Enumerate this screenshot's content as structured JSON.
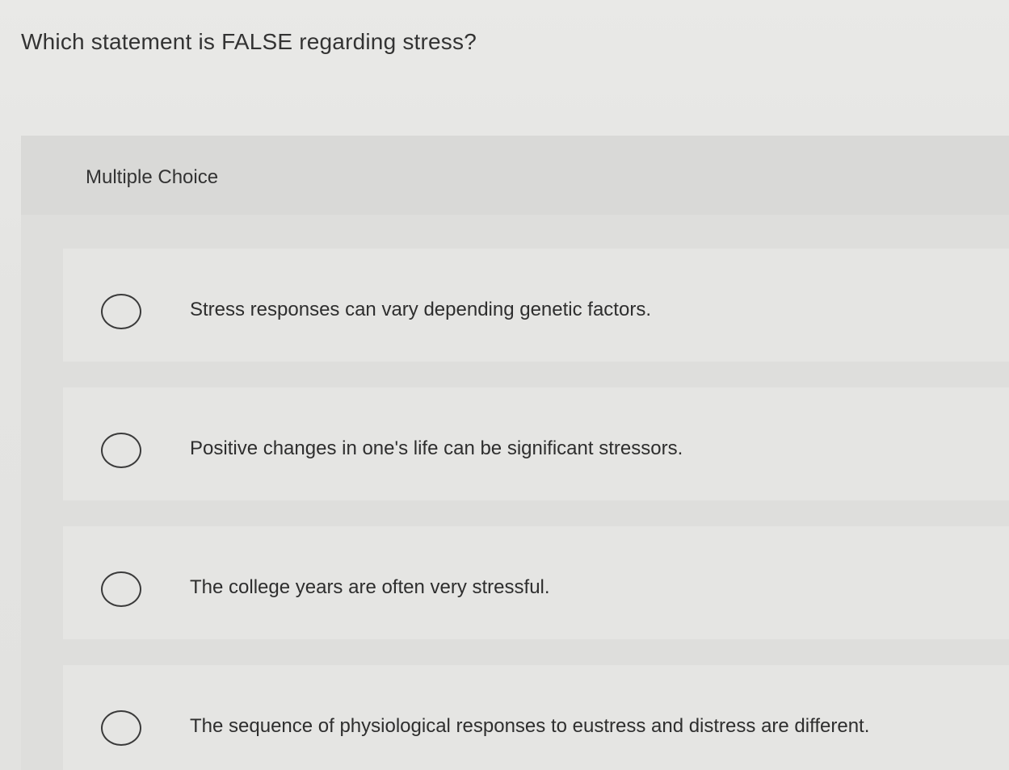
{
  "question": {
    "text": "Which statement is FALSE regarding stress?"
  },
  "panel": {
    "title": "Multiple Choice"
  },
  "options": [
    {
      "label": "Stress responses can vary depending genetic factors.",
      "selected": false
    },
    {
      "label": "Positive changes in one's life can be significant stressors.",
      "selected": false
    },
    {
      "label": "The college years are often very stressful.",
      "selected": false
    },
    {
      "label": "The sequence of physiological responses to eustress and distress are different.",
      "selected": false
    }
  ]
}
